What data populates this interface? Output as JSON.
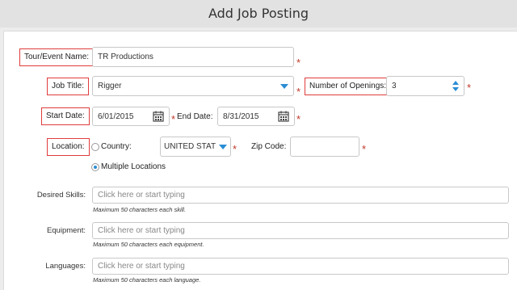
{
  "header": {
    "title": "Add Job Posting"
  },
  "form": {
    "tour_label": "Tour/Event Name:",
    "tour_value": "TR Productions",
    "job_title_label": "Job Title:",
    "job_title_value": "Rigger",
    "openings_label": "Number of Openings:",
    "openings_value": "3",
    "start_date_label": "Start Date:",
    "start_date_value": "6/01/2015",
    "end_date_label": "End Date:",
    "end_date_value": "8/31/2015",
    "location_label": "Location:",
    "country_label": "Country:",
    "country_value": "UNITED STAT",
    "zip_label": "Zip Code:",
    "zip_value": "",
    "multiple_locations_label": "Multiple Locations",
    "required_mark": "*",
    "skills_label": "Desired Skills:",
    "skills_placeholder": "Click here or start typing",
    "skills_hint": "Maximum 50 characters each skill.",
    "equipment_label": "Equipment:",
    "equipment_placeholder": "Click here or start typing",
    "equipment_hint": "Maximum 50 characters each equipment.",
    "languages_label": "Languages:",
    "languages_placeholder": "Click here or start typing",
    "languages_hint": "Maximum 50 characters each language."
  },
  "icons": {
    "calendar": "calendar-icon",
    "dropdown": "chevron-down-icon",
    "spinner": "spinner-arrows-icon"
  },
  "colors": {
    "accent": "#2a8dd4",
    "required": "#c0392b",
    "highlight_border": "#e03c3c"
  }
}
